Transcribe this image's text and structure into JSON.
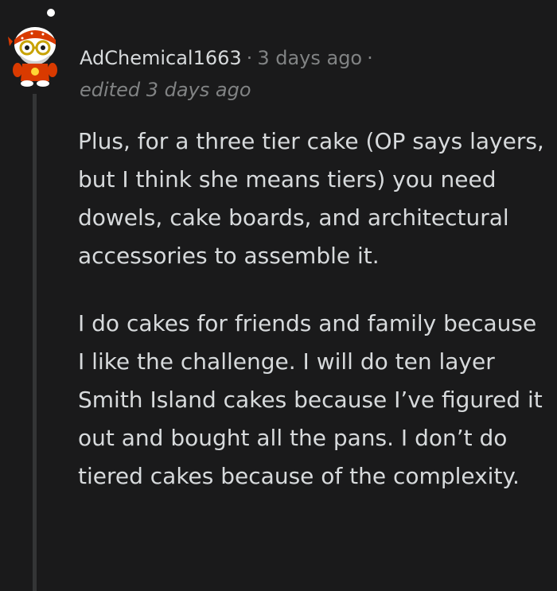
{
  "comment": {
    "username": "AdChemical1663",
    "separator": "·",
    "timestamp": "3 days ago",
    "trailing_separator": "·",
    "edited": "edited 3 days ago",
    "paragraphs": [
      "Plus, for a three tier cake (OP says layers, but I think she means tiers) you need dowels, cake boards, and architectural accessories to assemble it.",
      "I do cakes for friends and family because I like the challenge. I will do ten layer Smith Island cakes because I’ve figured it out and bought all the pans. I don’t do tiered cakes because of the complexity."
    ]
  },
  "colors": {
    "background": "#1a1a1b",
    "text": "#d7dadc",
    "muted": "#818384",
    "thread_line": "#343536"
  },
  "icons": {
    "avatar": "snoo-avatar-icon"
  }
}
